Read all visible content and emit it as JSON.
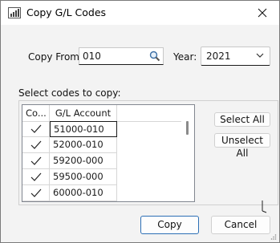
{
  "window": {
    "title": "Copy G/L Codes",
    "icon": "bar-chart-icon",
    "close_icon": "close-icon"
  },
  "form": {
    "copy_from_label": "Copy From:",
    "copy_from_value": "010",
    "search_icon": "search-icon",
    "year_label": "Year:",
    "year_value": "2021",
    "select_codes_label": "Select codes to copy:"
  },
  "grid": {
    "columns": [
      "Co...",
      "G/L Account"
    ],
    "rows": [
      {
        "checked": true,
        "account": "51000-010"
      },
      {
        "checked": true,
        "account": "52000-010"
      },
      {
        "checked": true,
        "account": "59200-000"
      },
      {
        "checked": true,
        "account": "59500-000"
      },
      {
        "checked": true,
        "account": "60000-010"
      }
    ],
    "selected_index": 0
  },
  "buttons": {
    "select_all": "Select All",
    "unselect_all": "Unselect All",
    "copy": "Copy",
    "cancel": "Cancel"
  },
  "colors": {
    "accent": "#2c6fb5",
    "window_bg": "#f3f3f3"
  }
}
